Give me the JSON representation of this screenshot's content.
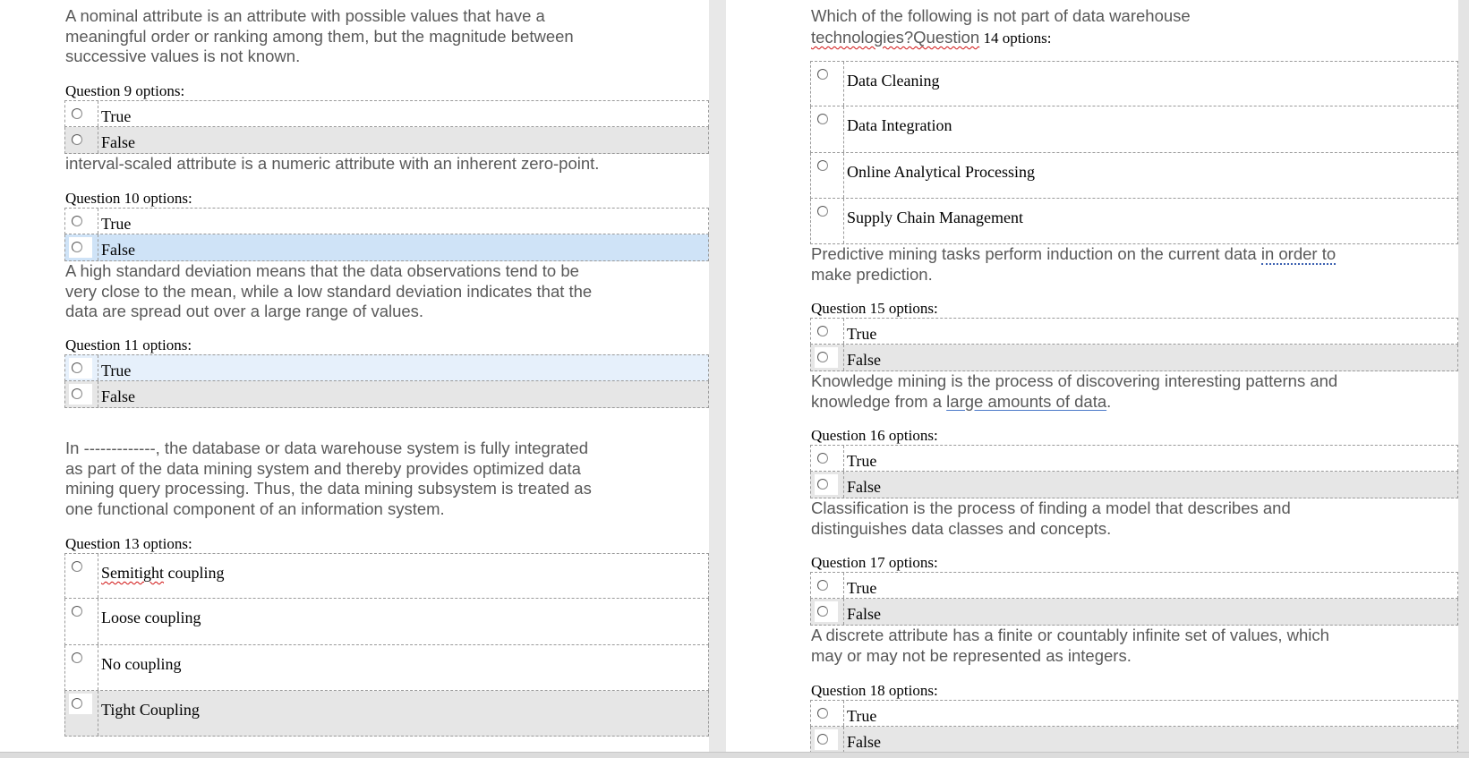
{
  "left_page": {
    "q9": {
      "statement_lines": [
        "A nominal attribute is an attribute with possible values that have a",
        "meaningful order or ranking among them, but the magnitude between",
        "successive values is not known."
      ],
      "label": "Question 9 options:",
      "options": [
        "True",
        "False"
      ]
    },
    "q10": {
      "statement_lines": [
        "interval-scaled attribute is a numeric attribute with an inherent zero-point."
      ],
      "label": "Question 10 options:",
      "options": [
        "True",
        "False"
      ]
    },
    "q11": {
      "statement_lines": [
        "A high standard deviation means that the data observations tend to be",
        "very close to the mean, while a low standard deviation indicates that the",
        "data are spread out over a large range of values."
      ],
      "label": "Question 11 options:",
      "options": [
        "True",
        "False"
      ]
    },
    "q13": {
      "statement_lines": [
        "In -------------, the database or data warehouse system is fully integrated",
        "as part of the data mining system and thereby provides optimized data",
        "mining query processing. Thus, the data mining subsystem is treated as",
        "one functional component of an information system."
      ],
      "label": "Question 13 options:",
      "option_1_word": "Semitight",
      "option_1_rest": " coupling",
      "options": [
        "Semitight coupling",
        "Loose coupling",
        "No coupling",
        "Tight Coupling"
      ]
    }
  },
  "right_page": {
    "q14": {
      "line1": "Which of the following is not part of data warehouse",
      "line2_word": "technologies?Question",
      "line2_rest": " 14 options:",
      "options": [
        "Data Cleaning",
        "Data Integration",
        "Online Analytical Processing",
        "Supply Chain Management"
      ]
    },
    "q15": {
      "line1_start": "Predictive mining tasks perform induction on the current data ",
      "line1_link": "in order to",
      "line2": "make prediction.",
      "label": "Question 15 options:",
      "options": [
        "True",
        "False"
      ]
    },
    "q16": {
      "line1": "Knowledge mining is the process of discovering interesting patterns and",
      "line2_start": "knowledge from a ",
      "line2_link": "large amounts of data",
      "line2_end": ".",
      "label": "Question 16 options:",
      "options": [
        "True",
        "False"
      ]
    },
    "q17": {
      "statement_lines": [
        "Classification is the process of finding a model that describes and",
        "distinguishes data classes and concepts."
      ],
      "label": "Question 17 options:",
      "options": [
        "True",
        "False"
      ]
    },
    "q18": {
      "statement_lines": [
        "A discrete attribute has a finite or countably infinite set of values, which",
        "may or may not be represented as integers."
      ],
      "label": "Question 18 options:",
      "options": [
        "True",
        "False"
      ]
    }
  },
  "colors": {
    "page": "#ffffff",
    "gutter": "#e8e8e8",
    "statement_text": "#595959",
    "option_grey": "#e6e6e6",
    "option_selected": "#cfe3f7",
    "option_hover": "#e6f0fb",
    "spellcheck": "#d01010"
  }
}
